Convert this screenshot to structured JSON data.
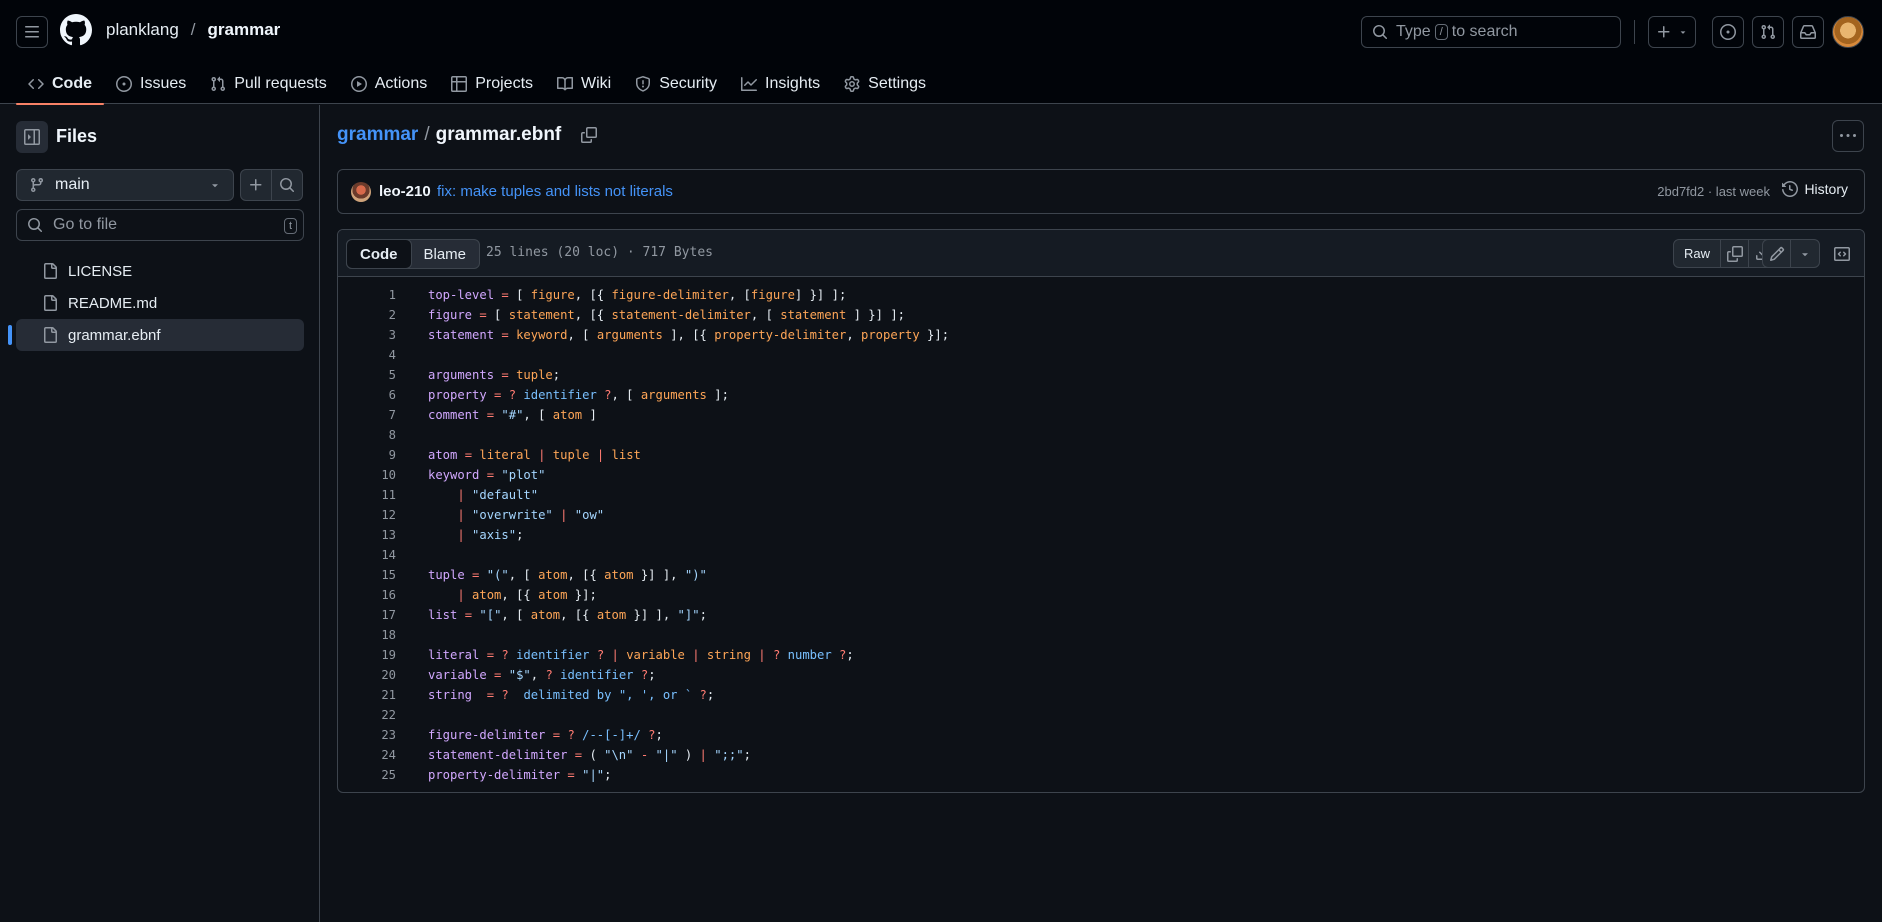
{
  "header": {
    "owner": "planklang",
    "separator": "/",
    "repo": "grammar",
    "search_prefix": "Type",
    "search_key": "/",
    "search_suffix": "to search"
  },
  "nav": {
    "tabs": [
      {
        "label": "Code",
        "icon": "code-icon",
        "active": true
      },
      {
        "label": "Issues",
        "icon": "issue-icon"
      },
      {
        "label": "Pull requests",
        "icon": "pull-request-icon"
      },
      {
        "label": "Actions",
        "icon": "play-icon"
      },
      {
        "label": "Projects",
        "icon": "table-icon"
      },
      {
        "label": "Wiki",
        "icon": "book-icon"
      },
      {
        "label": "Security",
        "icon": "shield-icon"
      },
      {
        "label": "Insights",
        "icon": "graph-icon"
      },
      {
        "label": "Settings",
        "icon": "gear-icon"
      }
    ]
  },
  "sidebar": {
    "title": "Files",
    "branch": "main",
    "goto_placeholder": "Go to file",
    "goto_key": "t",
    "files": [
      {
        "name": "LICENSE"
      },
      {
        "name": "README.md"
      },
      {
        "name": "grammar.ebnf",
        "selected": true
      }
    ]
  },
  "breadcrumb": {
    "repo": "grammar",
    "separator": "/",
    "file": "grammar.ebnf"
  },
  "commit": {
    "author": "leo-210",
    "message": "fix: make tuples and lists not literals",
    "meta": "2bd7fd2 · last week",
    "history_label": "History"
  },
  "file": {
    "tab_code": "Code",
    "tab_blame": "Blame",
    "stats": "25 lines (20 loc) · 717 Bytes",
    "raw_label": "Raw"
  },
  "code_lines": [
    [
      [
        "id",
        "top-level"
      ],
      [
        "p",
        " "
      ],
      [
        "op",
        "="
      ],
      [
        "p",
        " [ "
      ],
      [
        "ref",
        "figure"
      ],
      [
        "p",
        ", [{ "
      ],
      [
        "ref",
        "figure-delimiter"
      ],
      [
        "p",
        ", ["
      ],
      [
        "ref",
        "figure"
      ],
      [
        "p",
        "] }] ];"
      ]
    ],
    [
      [
        "id",
        "figure"
      ],
      [
        "p",
        " "
      ],
      [
        "op",
        "="
      ],
      [
        "p",
        " [ "
      ],
      [
        "ref",
        "statement"
      ],
      [
        "p",
        ", [{ "
      ],
      [
        "ref",
        "statement-delimiter"
      ],
      [
        "p",
        ", [ "
      ],
      [
        "ref",
        "statement"
      ],
      [
        "p",
        " ] }] ];"
      ]
    ],
    [
      [
        "id",
        "statement"
      ],
      [
        "p",
        " "
      ],
      [
        "op",
        "="
      ],
      [
        "p",
        " "
      ],
      [
        "ref",
        "keyword"
      ],
      [
        "p",
        ", [ "
      ],
      [
        "ref",
        "arguments"
      ],
      [
        "p",
        " ], [{ "
      ],
      [
        "ref",
        "property-delimiter"
      ],
      [
        "p",
        ", "
      ],
      [
        "ref",
        "property"
      ],
      [
        "p",
        " }];"
      ]
    ],
    [],
    [
      [
        "id",
        "arguments"
      ],
      [
        "p",
        " "
      ],
      [
        "op",
        "="
      ],
      [
        "p",
        " "
      ],
      [
        "ref",
        "tuple"
      ],
      [
        "p",
        ";"
      ]
    ],
    [
      [
        "id",
        "property"
      ],
      [
        "p",
        " "
      ],
      [
        "op",
        "="
      ],
      [
        "p",
        " "
      ],
      [
        "op",
        "?"
      ],
      [
        "p",
        " "
      ],
      [
        "sp",
        "identifier"
      ],
      [
        "p",
        " "
      ],
      [
        "op",
        "?"
      ],
      [
        "p",
        ", [ "
      ],
      [
        "ref",
        "arguments"
      ],
      [
        "p",
        " ];"
      ]
    ],
    [
      [
        "id",
        "comment"
      ],
      [
        "p",
        " "
      ],
      [
        "op",
        "="
      ],
      [
        "p",
        " "
      ],
      [
        "str",
        "\"#\""
      ],
      [
        "p",
        ", [ "
      ],
      [
        "ref",
        "atom"
      ],
      [
        "p",
        " ]"
      ]
    ],
    [],
    [
      [
        "id",
        "atom"
      ],
      [
        "p",
        " "
      ],
      [
        "op",
        "="
      ],
      [
        "p",
        " "
      ],
      [
        "ref",
        "literal"
      ],
      [
        "p",
        " "
      ],
      [
        "op",
        "|"
      ],
      [
        "p",
        " "
      ],
      [
        "ref",
        "tuple"
      ],
      [
        "p",
        " "
      ],
      [
        "op",
        "|"
      ],
      [
        "p",
        " "
      ],
      [
        "ref",
        "list"
      ]
    ],
    [
      [
        "id",
        "keyword"
      ],
      [
        "p",
        " "
      ],
      [
        "op",
        "="
      ],
      [
        "p",
        " "
      ],
      [
        "str",
        "\"plot\""
      ]
    ],
    [
      [
        "p",
        "    "
      ],
      [
        "op",
        "|"
      ],
      [
        "p",
        " "
      ],
      [
        "str",
        "\"default\""
      ]
    ],
    [
      [
        "p",
        "    "
      ],
      [
        "op",
        "|"
      ],
      [
        "p",
        " "
      ],
      [
        "str",
        "\"overwrite\""
      ],
      [
        "p",
        " "
      ],
      [
        "op",
        "|"
      ],
      [
        "p",
        " "
      ],
      [
        "str",
        "\"ow\""
      ]
    ],
    [
      [
        "p",
        "    "
      ],
      [
        "op",
        "|"
      ],
      [
        "p",
        " "
      ],
      [
        "str",
        "\"axis\""
      ],
      [
        "p",
        ";"
      ]
    ],
    [],
    [
      [
        "id",
        "tuple"
      ],
      [
        "p",
        " "
      ],
      [
        "op",
        "="
      ],
      [
        "p",
        " "
      ],
      [
        "str",
        "\"(\""
      ],
      [
        "p",
        ", [ "
      ],
      [
        "ref",
        "atom"
      ],
      [
        "p",
        ", [{ "
      ],
      [
        "ref",
        "atom"
      ],
      [
        "p",
        " }] ], "
      ],
      [
        "str",
        "\")\""
      ]
    ],
    [
      [
        "p",
        "    "
      ],
      [
        "op",
        "|"
      ],
      [
        "p",
        " "
      ],
      [
        "ref",
        "atom"
      ],
      [
        "p",
        ", [{ "
      ],
      [
        "ref",
        "atom"
      ],
      [
        "p",
        " }];"
      ]
    ],
    [
      [
        "id",
        "list"
      ],
      [
        "p",
        " "
      ],
      [
        "op",
        "="
      ],
      [
        "p",
        " "
      ],
      [
        "str",
        "\"[\""
      ],
      [
        "p",
        ", [ "
      ],
      [
        "ref",
        "atom"
      ],
      [
        "p",
        ", [{ "
      ],
      [
        "ref",
        "atom"
      ],
      [
        "p",
        " }] ], "
      ],
      [
        "str",
        "\"]\""
      ],
      [
        "p",
        ";"
      ]
    ],
    [],
    [
      [
        "id",
        "literal"
      ],
      [
        "p",
        " "
      ],
      [
        "op",
        "="
      ],
      [
        "p",
        " "
      ],
      [
        "op",
        "?"
      ],
      [
        "p",
        " "
      ],
      [
        "sp",
        "identifier"
      ],
      [
        "p",
        " "
      ],
      [
        "op",
        "?"
      ],
      [
        "p",
        " "
      ],
      [
        "op",
        "|"
      ],
      [
        "p",
        " "
      ],
      [
        "ref",
        "variable"
      ],
      [
        "p",
        " "
      ],
      [
        "op",
        "|"
      ],
      [
        "p",
        " "
      ],
      [
        "ref",
        "string"
      ],
      [
        "p",
        " "
      ],
      [
        "op",
        "|"
      ],
      [
        "p",
        " "
      ],
      [
        "op",
        "?"
      ],
      [
        "p",
        " "
      ],
      [
        "sp",
        "number"
      ],
      [
        "p",
        " "
      ],
      [
        "op",
        "?"
      ],
      [
        "p",
        ";"
      ]
    ],
    [
      [
        "id",
        "variable"
      ],
      [
        "p",
        " "
      ],
      [
        "op",
        "="
      ],
      [
        "p",
        " "
      ],
      [
        "str",
        "\"$\""
      ],
      [
        "p",
        ", "
      ],
      [
        "op",
        "?"
      ],
      [
        "p",
        " "
      ],
      [
        "sp",
        "identifier"
      ],
      [
        "p",
        " "
      ],
      [
        "op",
        "?"
      ],
      [
        "p",
        ";"
      ]
    ],
    [
      [
        "id",
        "string"
      ],
      [
        "p",
        "  "
      ],
      [
        "op",
        "="
      ],
      [
        "p",
        " "
      ],
      [
        "op",
        "?"
      ],
      [
        "p",
        "  "
      ],
      [
        "sp",
        "delimited by \", ', or ` "
      ],
      [
        "op",
        "?"
      ],
      [
        "p",
        ";"
      ]
    ],
    [],
    [
      [
        "id",
        "figure-delimiter"
      ],
      [
        "p",
        " "
      ],
      [
        "op",
        "="
      ],
      [
        "p",
        " "
      ],
      [
        "op",
        "?"
      ],
      [
        "p",
        " "
      ],
      [
        "sp",
        "/--[-]+/"
      ],
      [
        "p",
        " "
      ],
      [
        "op",
        "?"
      ],
      [
        "p",
        ";"
      ]
    ],
    [
      [
        "id",
        "statement-delimiter"
      ],
      [
        "p",
        " "
      ],
      [
        "op",
        "="
      ],
      [
        "p",
        " ( "
      ],
      [
        "str",
        "\"\\n\""
      ],
      [
        "p",
        " "
      ],
      [
        "op",
        "-"
      ],
      [
        "p",
        " "
      ],
      [
        "str",
        "\"|\""
      ],
      [
        "p",
        " ) "
      ],
      [
        "op",
        "|"
      ],
      [
        "p",
        " "
      ],
      [
        "str",
        "\";;\""
      ],
      [
        "p",
        ";"
      ]
    ],
    [
      [
        "id",
        "property-delimiter"
      ],
      [
        "p",
        " "
      ],
      [
        "op",
        "="
      ],
      [
        "p",
        " "
      ],
      [
        "str",
        "\"|\""
      ],
      [
        "p",
        ";"
      ]
    ]
  ]
}
